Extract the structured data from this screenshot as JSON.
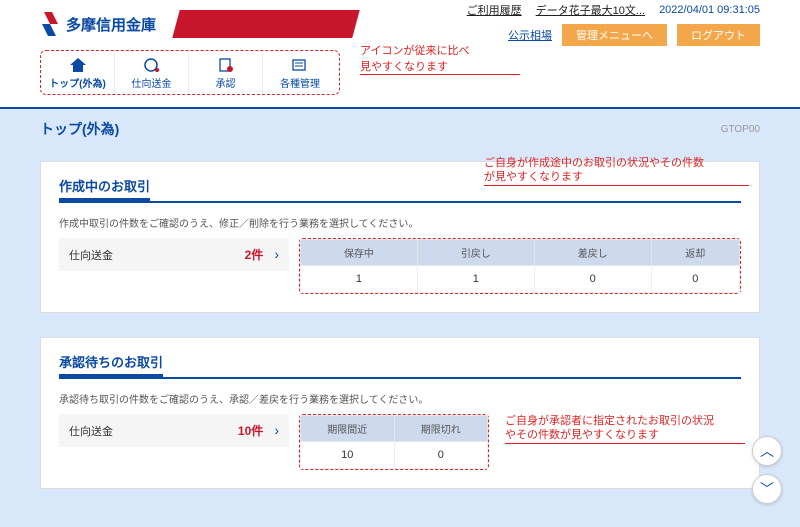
{
  "header": {
    "bank_name": "多摩信用金庫",
    "links": {
      "history": "ご利用履歴",
      "user": "データ花子最大10文..."
    },
    "timestamp": "2022/04/01 09:31:05",
    "notice": "公示相場",
    "btn_admin": "管理メニューへ",
    "btn_logout": "ログアウト"
  },
  "nav": {
    "items": [
      {
        "label": "トップ(外為)"
      },
      {
        "label": "仕向送金"
      },
      {
        "label": "承認"
      },
      {
        "label": "各種管理"
      }
    ]
  },
  "annotations": {
    "icons": "アイコンが従来に比べ\n見やすくなります",
    "creating": "ご自身が作成途中のお取引の状況やその件数\nが見やすくなります",
    "approval": "ご自身が承認者に指定されたお取引の状況\nやその件数が見やすくなります"
  },
  "page": {
    "title": "トップ(外為)",
    "code": "GTOP00"
  },
  "card1": {
    "title": "作成中のお取引",
    "desc": "作成中取引の件数をご確認のうえ、修正／削除を行う業務を選択してください。",
    "row_label": "仕向送金",
    "row_count": "2件",
    "headers": [
      "保存中",
      "引戻し",
      "差戻し",
      "返却"
    ],
    "values": [
      "1",
      "1",
      "0",
      "0"
    ]
  },
  "card2": {
    "title": "承認待ちのお取引",
    "desc": "承認待ち取引の件数をご確認のうえ、承認／差戻を行う業務を選択してください。",
    "row_label": "仕向送金",
    "row_count": "10件",
    "headers": [
      "期限間近",
      "期限切れ"
    ],
    "values": [
      "10",
      "0"
    ]
  }
}
